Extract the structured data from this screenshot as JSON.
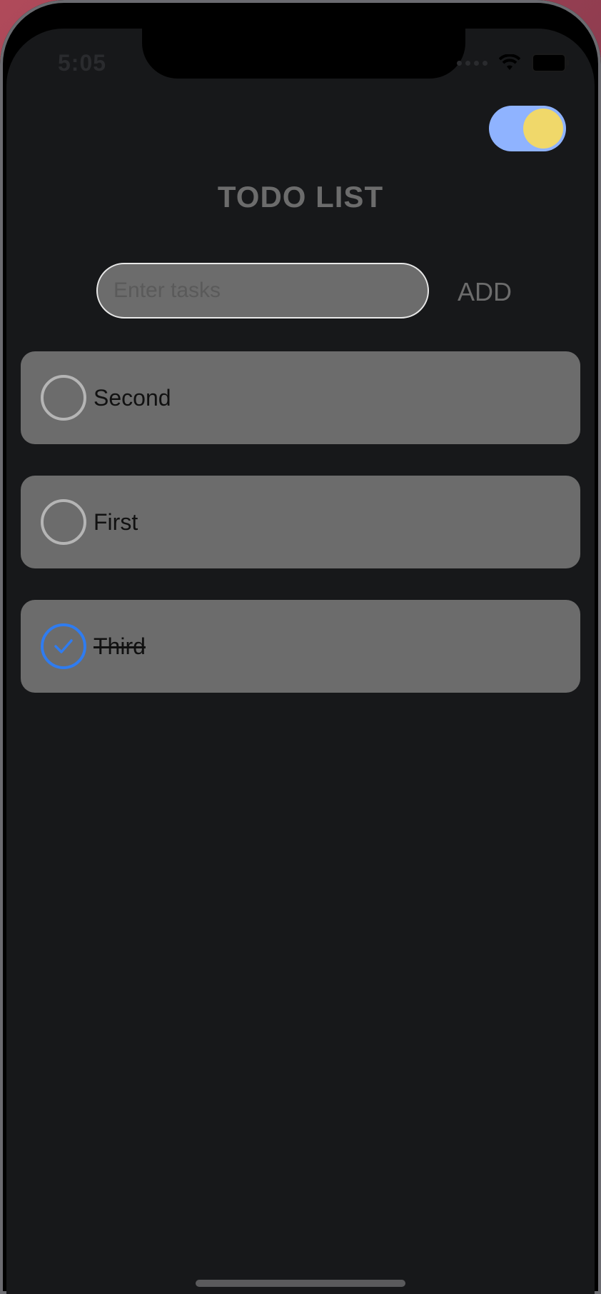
{
  "status": {
    "time": "5:05"
  },
  "theme_toggle": {
    "on": true,
    "track_color": "#8fb3ff",
    "knob_color": "#f0d86a"
  },
  "title": "TODO LIST",
  "input": {
    "placeholder": "Enter tasks",
    "value": ""
  },
  "add_button": {
    "label": "ADD"
  },
  "tasks": [
    {
      "label": "Second",
      "done": false
    },
    {
      "label": "First",
      "done": false
    },
    {
      "label": "Third",
      "done": true
    }
  ],
  "colors": {
    "background": "#17181a",
    "card": "#6c6c6c",
    "accent": "#2f7cf0"
  }
}
